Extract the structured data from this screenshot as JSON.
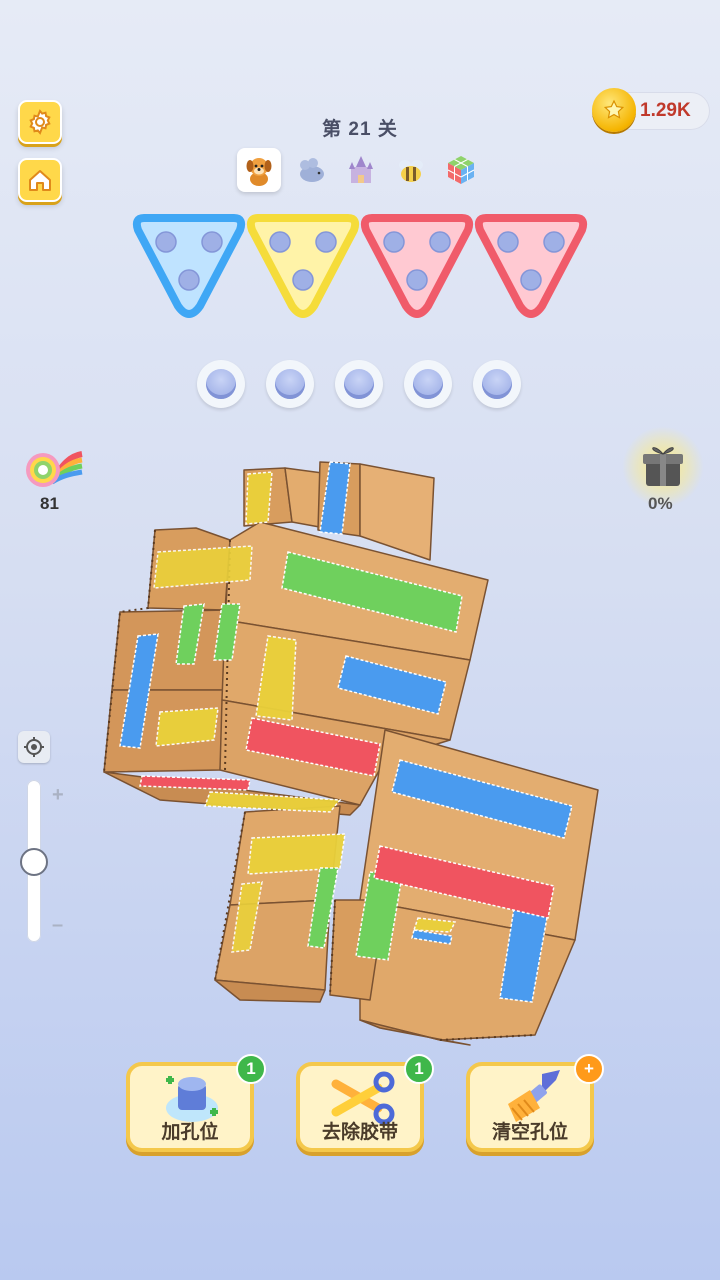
{
  "header": {
    "level_title": "第 21 关",
    "coins": "1.29K"
  },
  "top_left": {
    "settings": "gear-icon",
    "home": "home-icon"
  },
  "stages": [
    {
      "icon": "dog-icon",
      "active": true
    },
    {
      "icon": "mouse-icon",
      "active": false
    },
    {
      "icon": "castle-icon",
      "active": false
    },
    {
      "icon": "bee-icon",
      "active": false
    },
    {
      "icon": "cube-icon",
      "active": false
    }
  ],
  "trays": [
    {
      "color": "#3fa7f5",
      "fill": "#bfe3ff",
      "pegs": 3
    },
    {
      "color": "#f5dc3a",
      "fill": "#fff3a8",
      "pegs": 3
    },
    {
      "color": "#f05b6a",
      "fill": "#ffc9d2",
      "pegs": 3
    },
    {
      "color": "#f05b6a",
      "fill": "#ffc9d2",
      "pegs": 3
    }
  ],
  "hold_slots": 5,
  "side": {
    "tape_count": "81",
    "gift_progress": "0%"
  },
  "tools": [
    {
      "label": "加孔位",
      "badge": "1",
      "icon": "add-hole-icon"
    },
    {
      "label": "去除胶带",
      "badge": "1",
      "icon": "scissors-icon"
    },
    {
      "label": "清空孔位",
      "badge": "+",
      "icon": "brush-icon"
    }
  ],
  "colors": {
    "blue": "#4a9bef",
    "yellow": "#ead13a",
    "red": "#f05460",
    "green": "#6fd05d",
    "cardboard": "#dea76a"
  }
}
